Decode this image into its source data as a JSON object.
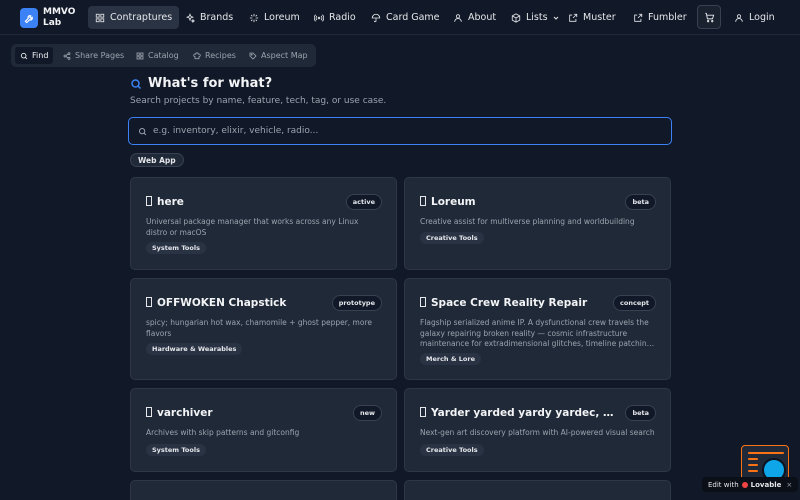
{
  "brand": {
    "name": "MMVO Lab"
  },
  "nav": {
    "items": [
      {
        "label": "Contraptures",
        "icon": "grid-icon"
      },
      {
        "label": "Brands",
        "icon": "sparkles-icon"
      },
      {
        "label": "Loreum",
        "icon": "sparkle-icon"
      },
      {
        "label": "Radio",
        "icon": "radio-icon"
      },
      {
        "label": "Card Game",
        "icon": "umbrella-icon"
      },
      {
        "label": "About",
        "icon": "user-icon"
      },
      {
        "label": "Lists",
        "icon": "box-icon"
      },
      {
        "label": "Muster",
        "icon": "external-link-icon"
      },
      {
        "label": "Fumbler",
        "icon": "external-link-icon"
      }
    ],
    "login": "Login"
  },
  "subnav": {
    "items": [
      {
        "label": "Find",
        "icon": "search-icon"
      },
      {
        "label": "Share Pages",
        "icon": "share-icon"
      },
      {
        "label": "Catalog",
        "icon": "grid-icon"
      },
      {
        "label": "Recipes",
        "icon": "chef-hat-icon"
      },
      {
        "label": "Aspect Map",
        "icon": "tag-icon"
      }
    ]
  },
  "main": {
    "heading": "What's for what?",
    "subtitle": "Search projects by name, feature, tech, tag, or use case.",
    "search_placeholder": "e.g. inventory, elixir, vehicle, radio...",
    "filter": "Web App"
  },
  "cards": [
    {
      "title": "here",
      "status": "active",
      "description": "Universal package manager that works across any Linux distro or macOS",
      "tag": "System Tools"
    },
    {
      "title": "Loreum",
      "status": "beta",
      "description": "Creative assist for multiverse planning and worldbuilding",
      "tag": "Creative Tools"
    },
    {
      "title": "OFFWOKEN Chapstick",
      "status": "prototype",
      "description": "spicy; hungarian hot wax, chamomile + ghost pepper, more flavors",
      "tag": "Hardware & Wearables"
    },
    {
      "title": "Space Crew Reality Repair",
      "status": "concept",
      "description": "Flagship serialized anime IP. A dysfunctional crew travels the galaxy repairing broken reality — cosmic infrastructure maintenance for extradimensional glitches, timeline patching, and the occasional existential crisis.",
      "tag": "Merch & Lore"
    },
    {
      "title": "varchiver",
      "status": "new",
      "description": "Archives with skip patterns and gitconfig",
      "tag": "System Tools"
    },
    {
      "title": "Yarder yarded yardy yardec, yarder",
      "status": "beta",
      "description": "Next-gen art discovery platform with AI-powered visual search",
      "tag": "Creative Tools"
    }
  ],
  "edit_badge": {
    "prefix": "Edit with",
    "brand": "Lovable"
  },
  "colors": {
    "accent": "#3b82f6",
    "background": "#111827",
    "card": "#1f2937"
  }
}
